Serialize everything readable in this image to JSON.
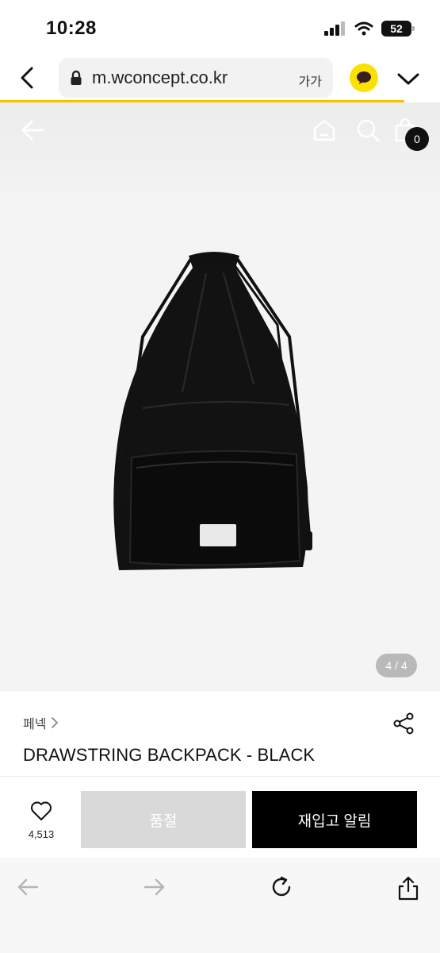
{
  "status": {
    "time": "10:28",
    "battery": "52"
  },
  "browser": {
    "url": "m.wconcept.co.kr",
    "text_size": "가가"
  },
  "hero": {
    "cart_count": "0",
    "page_indicator": "4 / 4"
  },
  "product": {
    "brand": "페넥",
    "title": "DRAWSTRING BACKPACK - BLACK",
    "wish_count": "4,513",
    "soldout_label": "품절",
    "restock_label": "재입고 알림"
  },
  "icons": [
    "back-chevron-icon",
    "lock-icon",
    "kakao-icon",
    "chevron-down-icon",
    "arrow-left-icon",
    "home-icon",
    "search-icon",
    "bag-icon",
    "share-icon",
    "heart-icon",
    "nav-back-icon",
    "nav-forward-icon",
    "reload-icon",
    "share-up-icon"
  ],
  "colors": {
    "progress": "#f5c400",
    "kakao": "#fae100",
    "soldout_bg": "#d9d9d9",
    "primary": "#000000"
  }
}
